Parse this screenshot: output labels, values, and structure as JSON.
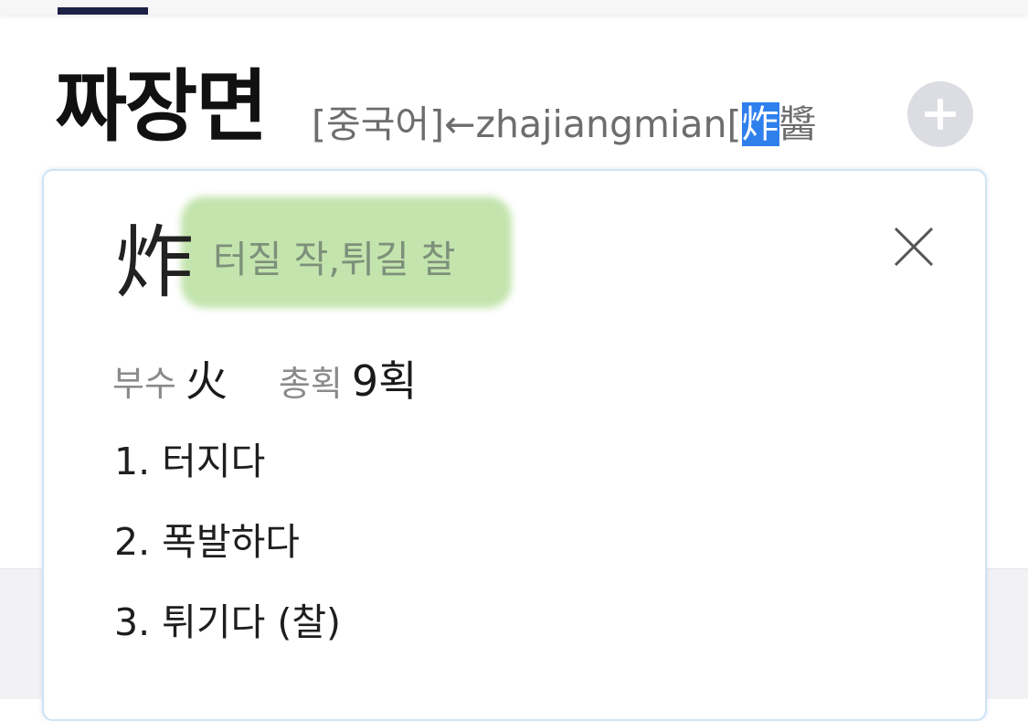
{
  "entry": {
    "headword": "짜장면",
    "origin_prefix": "[중국어]←zhajiangmian[",
    "origin_selected": "炸",
    "origin_suffix": "醬"
  },
  "add_button": {
    "icon": "plus-icon"
  },
  "hanja_popup": {
    "character": "炸",
    "meaning": "터질 작,튀길 찰",
    "radical_label": "부수",
    "radical_value": "火",
    "strokes_label": "총획",
    "strokes_value": "9획",
    "definitions": [
      "1. 터지다",
      "2. 폭발하다",
      "3. 튀기다 (찰)"
    ],
    "close_icon": "close-icon"
  },
  "colors": {
    "selection": "#2f80ed",
    "highlight": "#c3e4ad",
    "tab_indicator": "#1c2145"
  }
}
